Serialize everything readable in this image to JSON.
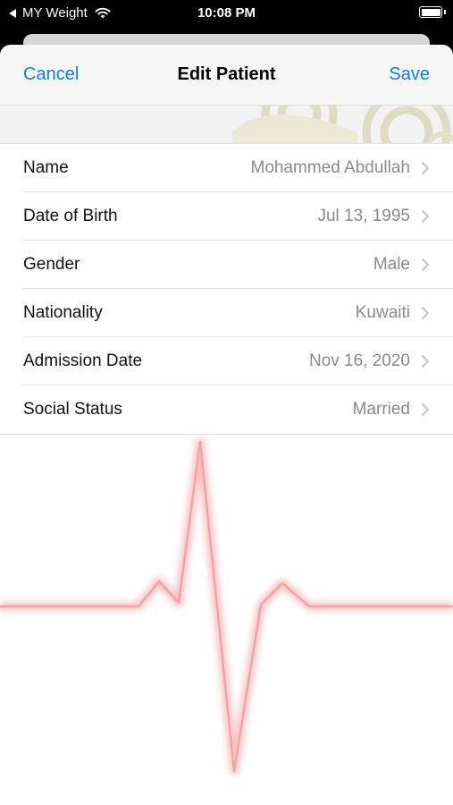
{
  "status_bar": {
    "back_app": "MY Weight",
    "time": "10:08 PM"
  },
  "navbar": {
    "cancel_label": "Cancel",
    "title": "Edit Patient",
    "save_label": "Save"
  },
  "patient_fields": [
    {
      "label": "Name",
      "value": "Mohammed Abdullah"
    },
    {
      "label": "Date of Birth",
      "value": "Jul 13, 1995"
    },
    {
      "label": "Gender",
      "value": "Male"
    },
    {
      "label": "Nationality",
      "value": "Kuwaiti"
    },
    {
      "label": "Admission Date",
      "value": "Nov 16, 2020"
    },
    {
      "label": "Social Status",
      "value": "Married"
    }
  ],
  "colors": {
    "accent": "#0a7aff",
    "value_text": "#8a8a8e",
    "ecg_line": "#f4a3a6"
  },
  "icons": {
    "back": "back-triangle-icon",
    "wifi": "wifi-icon",
    "battery": "battery-icon",
    "chevron": "chevron-right-icon"
  }
}
